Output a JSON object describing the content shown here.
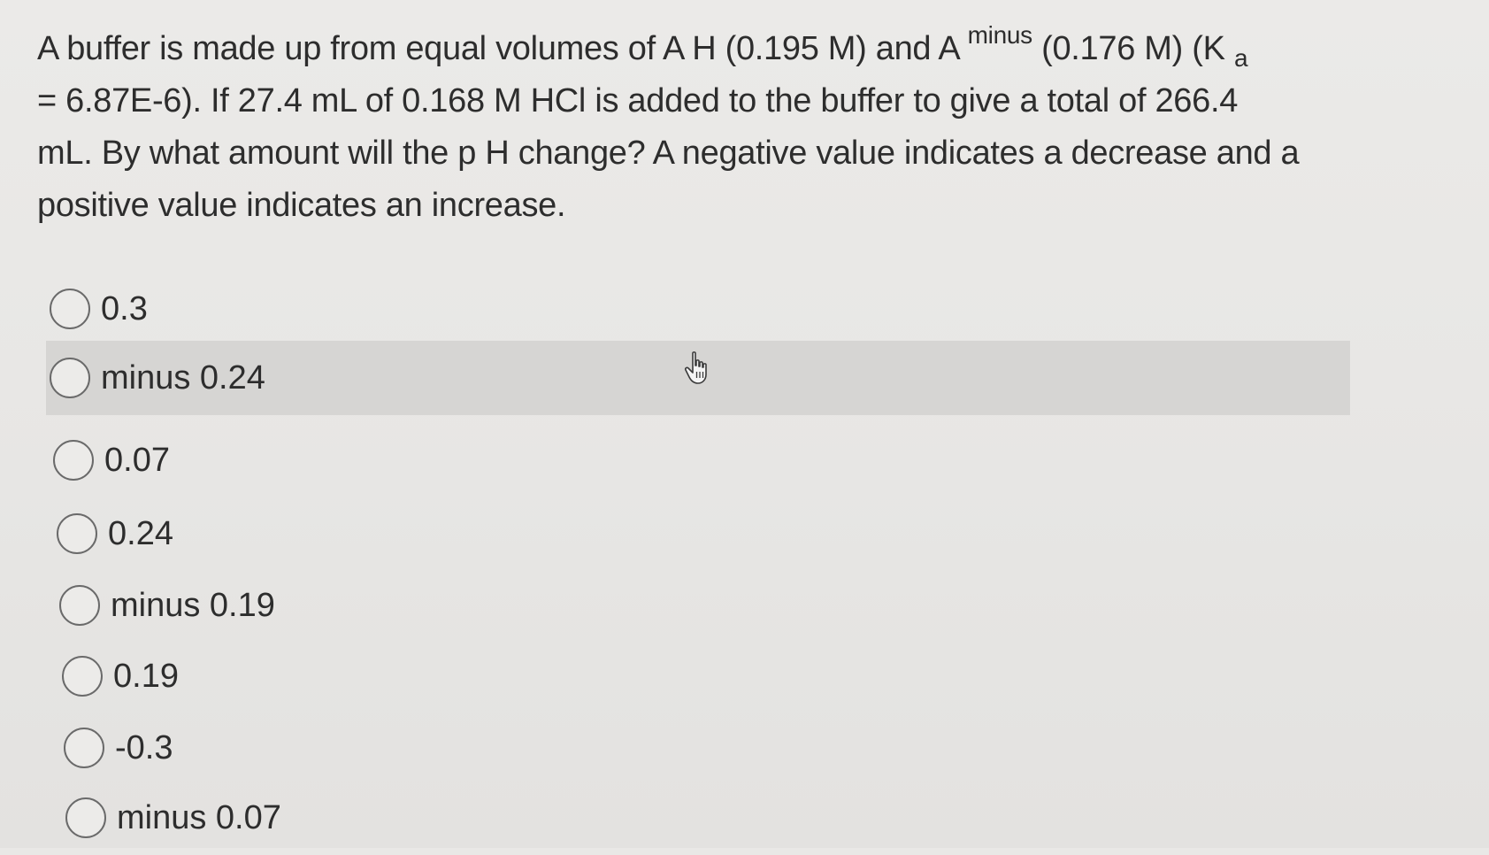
{
  "question": {
    "line1_a": "A buffer is made up from equal volumes of A H (0.195 M) and A ",
    "line1_sup": "minus",
    "line1_b": " (0.176 M) (K ",
    "line1_sub": "a",
    "line2": "= 6.87E-6). If 27.4 mL of 0.168 M HCl is added to the buffer to give a total of 266.4",
    "line3": "mL. By what amount will the p H change? A negative value indicates a decrease and a",
    "line4": "positive value indicates an increase."
  },
  "options": [
    {
      "label": "0.3",
      "selected": false
    },
    {
      "label": "minus 0.24",
      "selected": false,
      "hovered": true
    },
    {
      "label": "0.07",
      "selected": false
    },
    {
      "label": "0.24",
      "selected": false
    },
    {
      "label": "minus 0.19",
      "selected": false
    },
    {
      "label": "0.19",
      "selected": false
    },
    {
      "label": "-0.3",
      "selected": false
    },
    {
      "label": "minus 0.07",
      "selected": false
    }
  ],
  "cursor": {
    "icon": "hand-pointer-icon"
  }
}
